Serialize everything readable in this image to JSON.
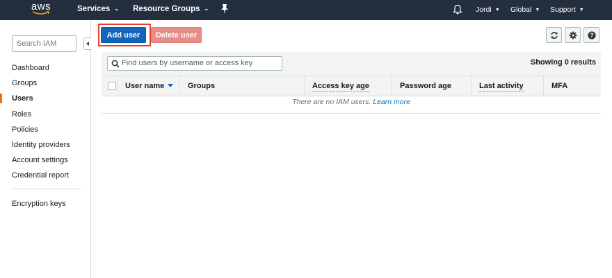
{
  "topnav": {
    "logo": "aws",
    "services": "Services",
    "resource_groups": "Resource Groups",
    "user": "Jordi",
    "region": "Global",
    "support": "Support"
  },
  "sidebar": {
    "search_placeholder": "Search IAM",
    "items": [
      {
        "label": "Dashboard"
      },
      {
        "label": "Groups"
      },
      {
        "label": "Users"
      },
      {
        "label": "Roles"
      },
      {
        "label": "Policies"
      },
      {
        "label": "Identity providers"
      },
      {
        "label": "Account settings"
      },
      {
        "label": "Credential report"
      }
    ],
    "active": "Users",
    "encryption_keys": "Encryption keys"
  },
  "toolbar": {
    "add_user": "Add user",
    "delete_user": "Delete user",
    "icons": [
      "refresh-icon",
      "gear-icon",
      "help-icon"
    ]
  },
  "table": {
    "filter_placeholder": "Find users by username or access key",
    "showing": "Showing 0 results",
    "columns": [
      "User name",
      "Groups",
      "Access key age",
      "Password age",
      "Last activity",
      "MFA"
    ],
    "empty_text": "There are no IAM users.",
    "learn_more": "Learn more"
  },
  "colors": {
    "nav_bg": "#232f3e",
    "primary": "#1166bb",
    "danger_disabled": "#e58d86",
    "accent": "#ec7211",
    "highlight": "#e8402e"
  }
}
